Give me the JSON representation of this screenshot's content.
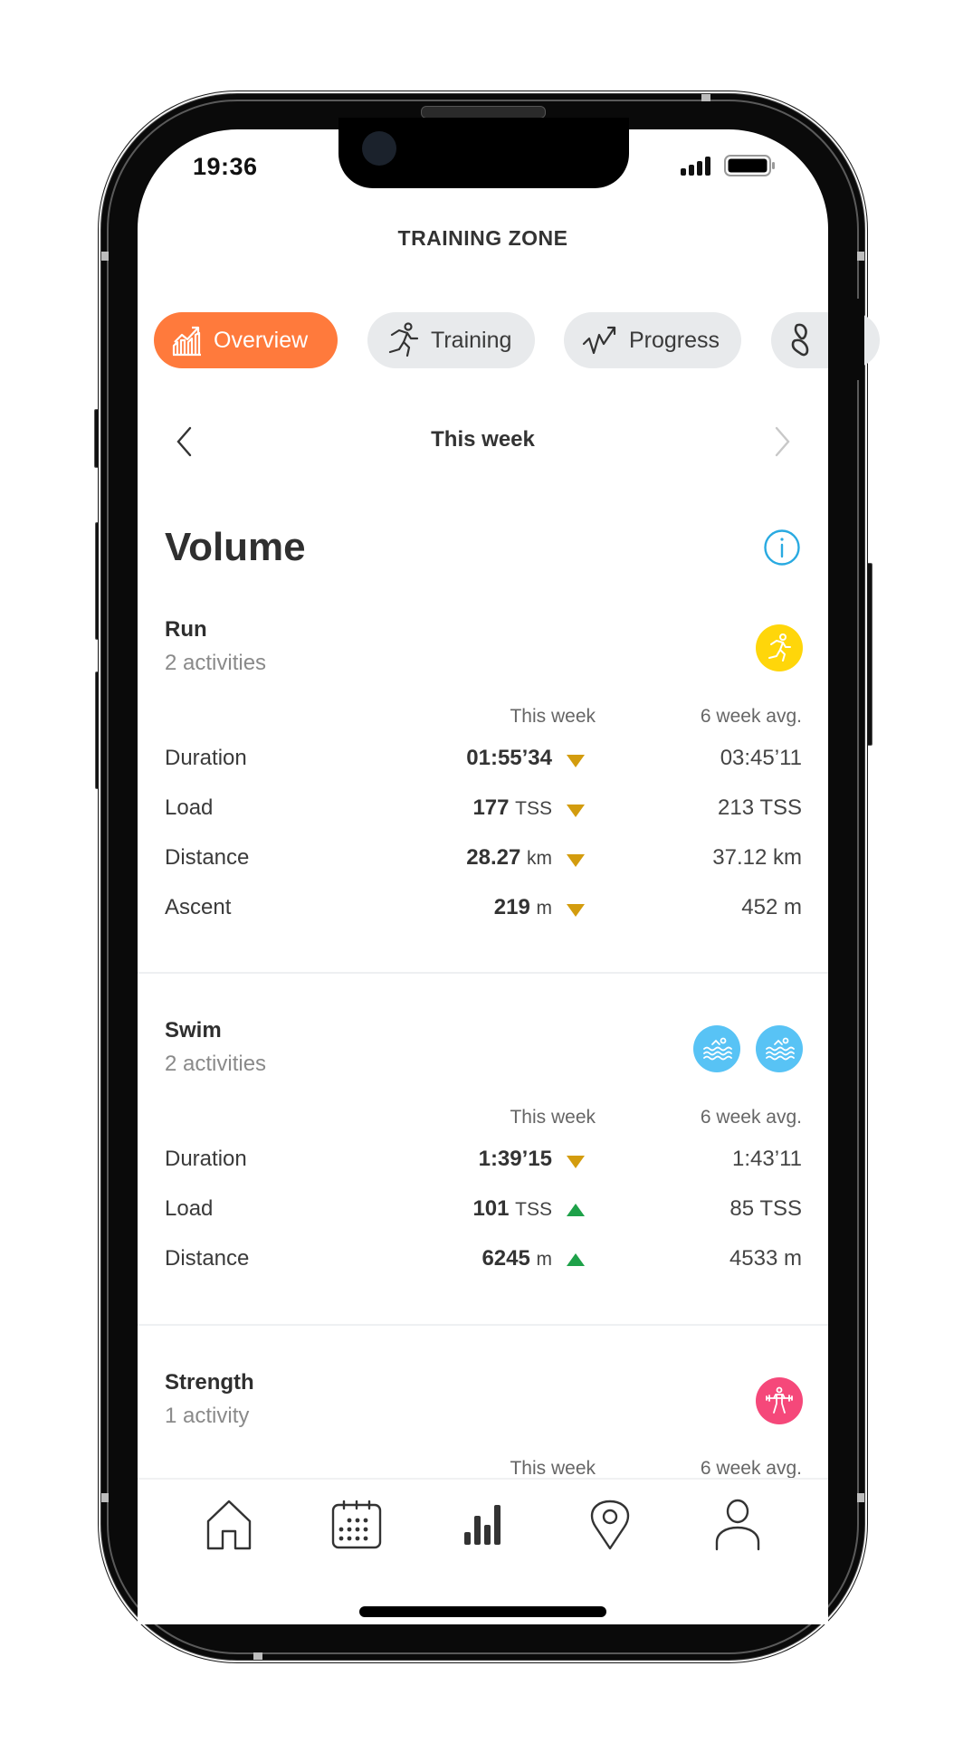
{
  "status_bar": {
    "time": "19:36",
    "signal_icon": "cellular-signal-icon",
    "battery_icon": "battery-full-icon"
  },
  "header": {
    "title": "TRAINING ZONE"
  },
  "tabs": [
    {
      "label": "Overview",
      "icon": "chart-trend-icon",
      "active": true
    },
    {
      "label": "Training",
      "icon": "runner-icon",
      "active": false
    },
    {
      "label": "Progress",
      "icon": "progress-line-icon",
      "active": false
    },
    {
      "label": "",
      "icon": "footprints-icon",
      "active": false
    }
  ],
  "period": {
    "label": "This week",
    "prev_icon": "chevron-left-icon",
    "next_icon": "chevron-right-icon",
    "next_enabled": false
  },
  "volume": {
    "title": "Volume",
    "info_icon": "info-icon",
    "column_headers": {
      "current": "This week",
      "average": "6 week avg."
    },
    "sections": [
      {
        "sport": "Run",
        "activity_count": "2 activities",
        "icon_color": "#ffd60a",
        "icons": [
          "run-icon"
        ],
        "rows": [
          {
            "label": "Duration",
            "value": "01:55’34",
            "unit": "",
            "trend": "down",
            "avg": "03:45’11"
          },
          {
            "label": "Load",
            "value": "177",
            "unit": "TSS",
            "trend": "down",
            "avg": "213 TSS"
          },
          {
            "label": "Distance",
            "value": "28.27",
            "unit": "km",
            "trend": "down",
            "avg": "37.12 km"
          },
          {
            "label": "Ascent",
            "value": "219",
            "unit": "m",
            "trend": "down",
            "avg": "452 m"
          }
        ]
      },
      {
        "sport": "Swim",
        "activity_count": "2 activities",
        "icon_color": "#58c3f5",
        "icons": [
          "swim-icon",
          "swim-icon"
        ],
        "rows": [
          {
            "label": "Duration",
            "value": "1:39’15",
            "unit": "",
            "trend": "down",
            "avg": "1:43’11"
          },
          {
            "label": "Load",
            "value": "101",
            "unit": "TSS",
            "trend": "up",
            "avg": "85 TSS"
          },
          {
            "label": "Distance",
            "value": "6245",
            "unit": "m",
            "trend": "up",
            "avg": "4533 m"
          }
        ]
      },
      {
        "sport": "Strength",
        "activity_count": "1 activity",
        "icon_color": "#f5487a",
        "icons": [
          "weightlifting-icon"
        ],
        "rows": []
      }
    ]
  },
  "colors": {
    "accent": "#ff7a3c",
    "trend_down": "#d39c0e",
    "trend_up": "#1ea149",
    "info": "#29aae1",
    "tab_inactive": "#e8eaec"
  },
  "bottom_nav": [
    {
      "icon": "home-icon"
    },
    {
      "icon": "calendar-icon"
    },
    {
      "icon": "bar-chart-icon",
      "active": true
    },
    {
      "icon": "map-pin-icon"
    },
    {
      "icon": "profile-icon"
    }
  ]
}
